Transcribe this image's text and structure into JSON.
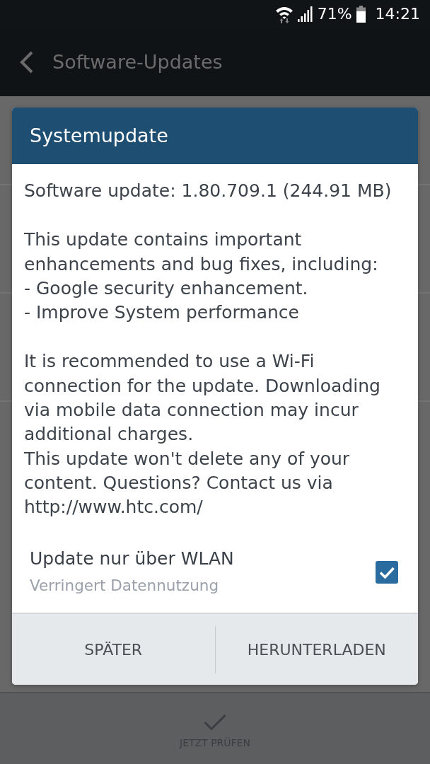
{
  "status_bar": {
    "battery_percent": "71%",
    "time": "14:21"
  },
  "app_bar": {
    "title": "Software-Updates"
  },
  "dialog": {
    "title": "Systemupdate",
    "paragraphs": [
      "Software update: 1.80.709.1 (244.91 MB)",
      "This update contains important enhancements and bug fixes, including:\n- Google security enhancement.\n- Improve System performance",
      "It is recommended to use a Wi-Fi connection for the update. Downloading via mobile data connection may incur additional charges.\nThis update won't delete any of your content. Questions? Contact us via http://www.htc.com/"
    ],
    "option": {
      "label": "Update nur über WLAN",
      "summary": "Verringert Datennutzung",
      "checked": true
    },
    "buttons": [
      {
        "label": "SPÄTER"
      },
      {
        "label": "HERUNTERLADEN"
      }
    ]
  },
  "bottom_bar": {
    "action": {
      "label": "JETZT PRÜFEN"
    }
  }
}
